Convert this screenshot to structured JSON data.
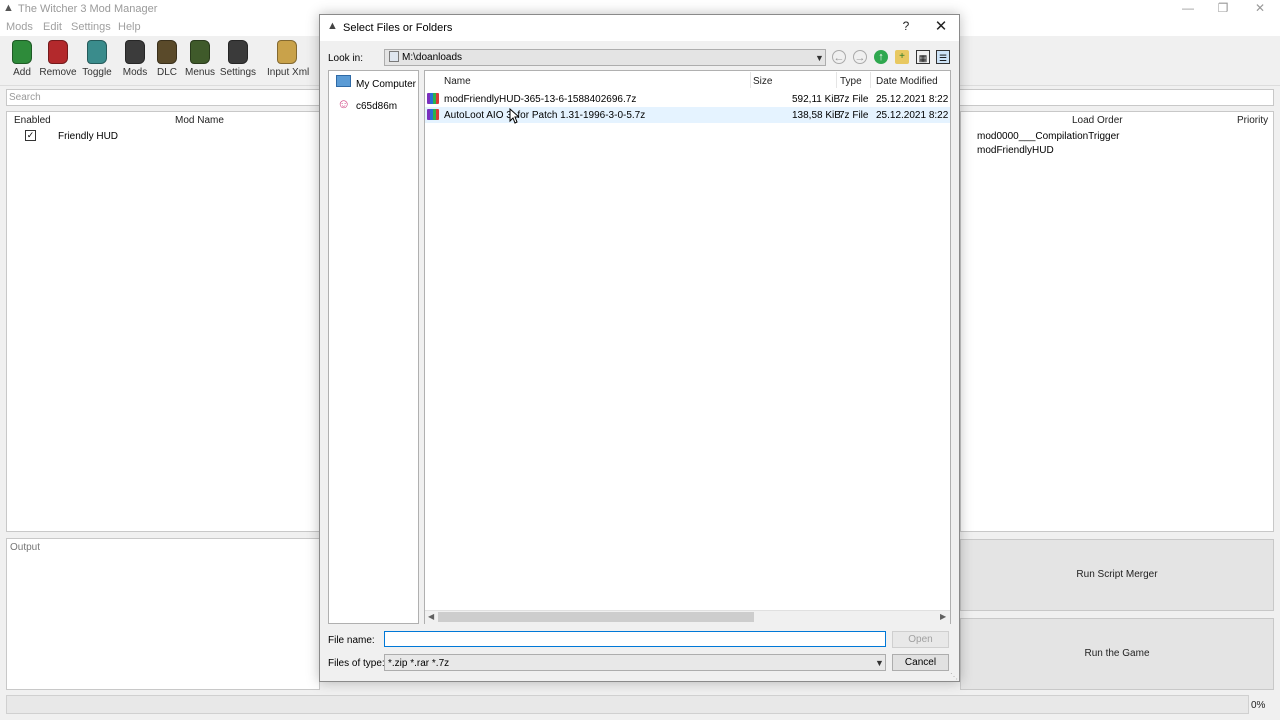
{
  "app": {
    "title": "The Witcher 3 Mod Manager",
    "menu": [
      "Mods",
      "Edit",
      "Settings",
      "Help"
    ],
    "toolbar": [
      {
        "label": "Add",
        "color": "#2e8b3a"
      },
      {
        "label": "Remove",
        "color": "#b3292c"
      },
      {
        "label": "Toggle",
        "color": "#3a8c8c"
      },
      {
        "label": "Mods",
        "color": "#3b3b3b"
      },
      {
        "label": "DLC",
        "color": "#5a4a2a"
      },
      {
        "label": "Menus",
        "color": "#3f5a2a"
      },
      {
        "label": "Settings",
        "color": "#3a3a3a"
      },
      {
        "label": "Input Xml",
        "color": "#c9a24a"
      }
    ],
    "search_placeholder": "Search",
    "mods_table": {
      "headers": {
        "enabled": "Enabled",
        "name": "Mod Name"
      },
      "rows": [
        {
          "enabled": true,
          "name": "Friendly HUD"
        }
      ]
    },
    "output_label": "Output",
    "load_order": {
      "headers": {
        "order": "Load Order",
        "priority": "Priority"
      },
      "items": [
        "mod0000___CompilationTrigger",
        "modFriendlyHUD"
      ]
    },
    "buttons": {
      "run_script_merger": "Run Script Merger",
      "run_game": "Run the Game"
    },
    "progress": "0%"
  },
  "dialog": {
    "title": "Select Files or Folders",
    "help": "?",
    "close": "✕",
    "look_in_label": "Look in:",
    "look_in_value": "M:\\doanloads",
    "sidebar": [
      "My Computer",
      "c65d86m"
    ],
    "columns": {
      "name": "Name",
      "size": "Size",
      "type": "Type",
      "date": "Date Modified"
    },
    "files": [
      {
        "name": "modFriendlyHUD-365-13-6-1588402696.7z",
        "size": "592,11 KiB",
        "type": "7z File",
        "date": "25.12.2021 8:22",
        "selected": false
      },
      {
        "name": "AutoLoot AIO 3. for Patch 1.31-1996-3-0-5.7z",
        "size": "138,58 KiB",
        "type": "7z File",
        "date": "25.12.2021 8:22",
        "selected": true
      }
    ],
    "file_name_label": "File name:",
    "file_name_value": "",
    "files_of_type_label": "Files of type:",
    "files_of_type_value": "*.zip *.rar *.7z",
    "open_button": "Open",
    "cancel_button": "Cancel",
    "accent": "#0078d7"
  }
}
